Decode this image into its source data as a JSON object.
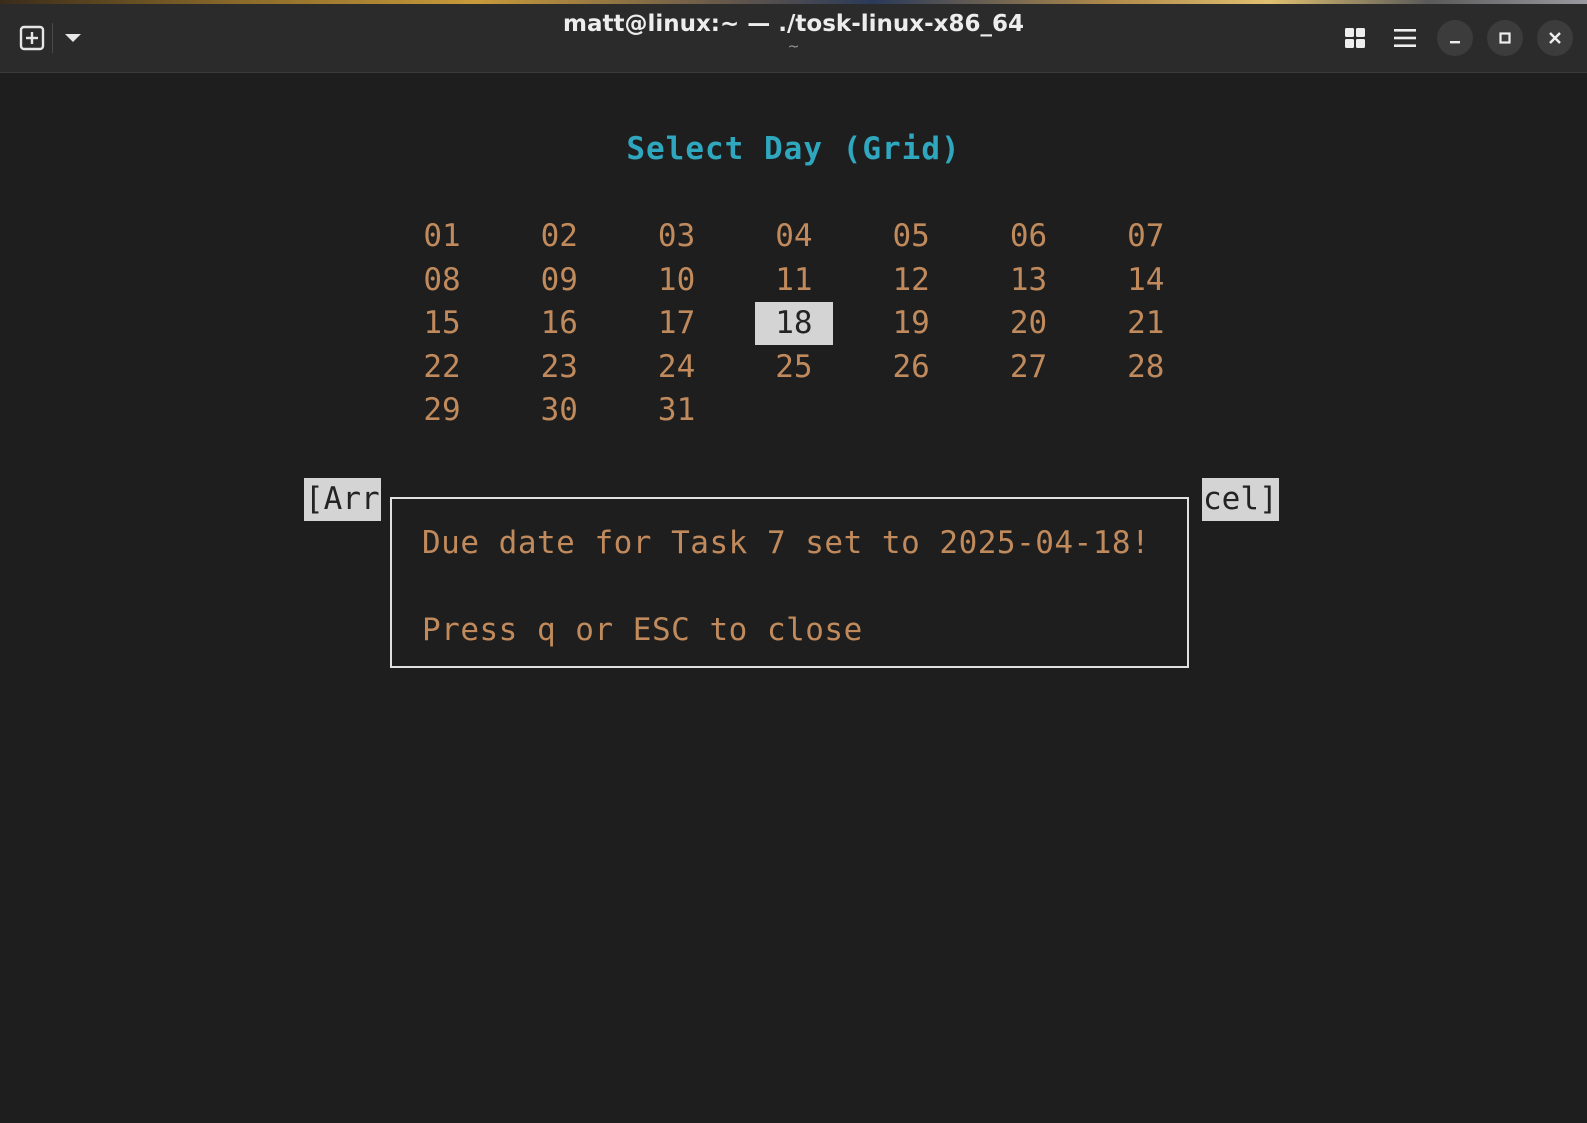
{
  "window": {
    "title": "matt@linux:~ — ./tosk-linux-x86_64",
    "subtitle": "~",
    "icons": {
      "new_tab": "new-tab-icon",
      "menu_dropdown": "chevron-down-icon",
      "tab_overview": "grid-icon",
      "hamburger": "menu-icon",
      "minimize": "minimize-icon",
      "maximize": "maximize-icon",
      "close": "close-icon"
    }
  },
  "picker": {
    "heading": "Select Day (Grid)",
    "days": [
      "01",
      "02",
      "03",
      "04",
      "05",
      "06",
      "07",
      "08",
      "09",
      "10",
      "11",
      "12",
      "13",
      "14",
      "15",
      "16",
      "17",
      "18",
      "19",
      "20",
      "21",
      "22",
      "23",
      "24",
      "25",
      "26",
      "27",
      "28",
      "29",
      "30",
      "31"
    ],
    "selected_day": "18",
    "hint_left_fragment": "[Arr",
    "hint_right_fragment": "cel]"
  },
  "dialog": {
    "message": "Due date for Task 7 set to 2025-04-18!",
    "instruction": "Press q or ESC to close"
  },
  "colors": {
    "background": "#1e1e1e",
    "heading": "#2ea7bf",
    "day_text": "#c08a5c",
    "selection_bg": "#d4d4d4",
    "dialog_border": "#e0e0e0"
  }
}
